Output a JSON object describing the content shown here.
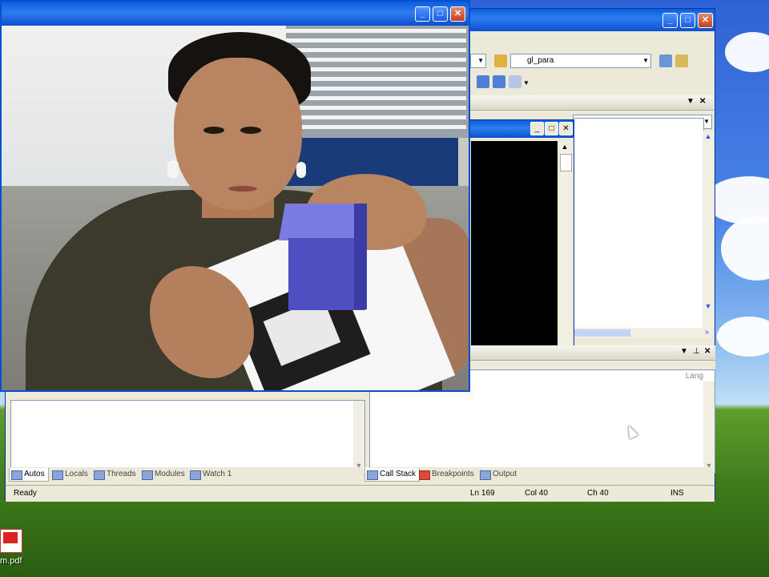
{
  "toolbar": {
    "combo_left": "",
    "combo_right": "gl_para"
  },
  "bottom_tabs_left": [
    {
      "label": "Autos",
      "active": true
    },
    {
      "label": "Locals",
      "active": false
    },
    {
      "label": "Threads",
      "active": false
    },
    {
      "label": "Modules",
      "active": false
    },
    {
      "label": "Watch 1",
      "active": false
    }
  ],
  "bottom_tabs_right": [
    {
      "label": "Call Stack",
      "active": true
    },
    {
      "label": "Breakpoints",
      "active": false
    },
    {
      "label": "Output",
      "active": false
    }
  ],
  "callstack": {
    "column_lang": "Lang"
  },
  "status": {
    "text": "Ready",
    "ln": "Ln 169",
    "col": "Col 40",
    "ch": "Ch 40",
    "mode": "INS"
  },
  "window_controls": {
    "minimize": "_",
    "maximize": "□",
    "close": "✕"
  },
  "desktop": {
    "icon_label": "m.pdf"
  },
  "colors": {
    "xp_title": "#0b4fcf",
    "cube": "#4f4fc2",
    "xp_face": "#ece9d8"
  }
}
